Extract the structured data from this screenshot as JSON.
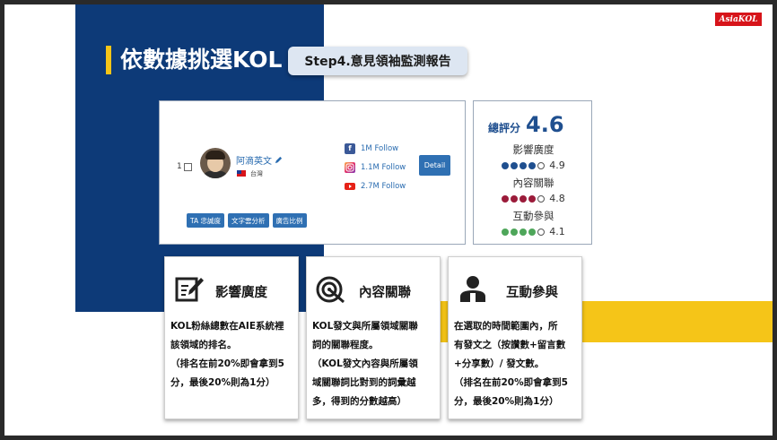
{
  "header": {
    "title": "依數據挑選KOL",
    "step": "Step4.意見領袖監測報告",
    "logo": "AsiaKOL"
  },
  "kol": {
    "rank": "1",
    "name": "阿滴英文",
    "country": "台灣",
    "social": [
      {
        "icon": "facebook-icon",
        "label": "1M Follow"
      },
      {
        "icon": "instagram-icon",
        "label": "1.1M Follow"
      },
      {
        "icon": "youtube-icon",
        "label": "2.7M Follow"
      }
    ],
    "detail_label": "Detail",
    "tags": [
      "TA 忠誠度",
      "文字雲分析",
      "廣告比例"
    ]
  },
  "scores": {
    "total_label": "總評分",
    "total_value": "4.6",
    "metrics": [
      {
        "label": "影響廣度",
        "value": "4.9",
        "filled": 4,
        "color": "#1f4f8f"
      },
      {
        "label": "內容關聯",
        "value": "4.8",
        "filled": 4,
        "color": "#9b1b3a"
      },
      {
        "label": "互動參與",
        "value": "4.1",
        "filled": 4,
        "color": "#4ea65a"
      }
    ]
  },
  "cards": [
    {
      "title": "影響廣度",
      "icon": "pencil-edit-icon",
      "text": "KOL粉絲總數在AIE系統裡\n該領域的排名。\n（排名在前20%即會拿到5\n分，最後20%則為1分）"
    },
    {
      "title": "內容關聯",
      "icon": "target-icon",
      "text": "KOL發文與所屬領域關聯\n詞的關聯程度。\n（KOL發文內容與所屬領\n域關聯詞比對到的詞彙越\n多，得到的分數越高）"
    },
    {
      "title": "互動參與",
      "icon": "user-icon",
      "text": "在選取的時間範圍內，所\n有發文之（按讚數+留言數\n+分享數）/ 發文數。\n（排名在前20%即會拿到5\n分，最後20%則為1分）"
    }
  ],
  "colors": {
    "brand_blue": "#0d3a78",
    "accent_yellow": "#f5c518",
    "button_blue": "#2f70b3"
  }
}
